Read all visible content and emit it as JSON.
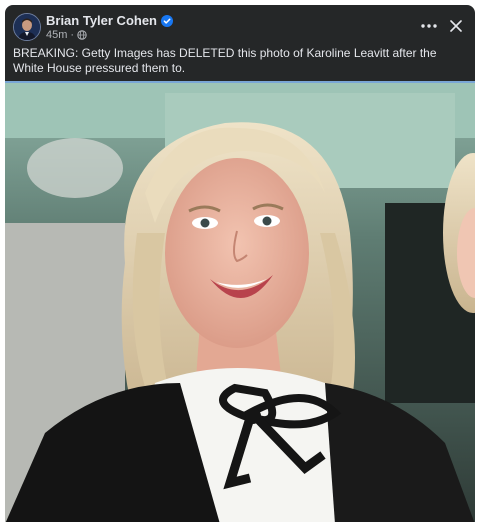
{
  "post": {
    "author": "Brian Tyler Cohen",
    "timestamp": "45m",
    "separator": "·",
    "caption": "BREAKING: Getty Images has DELETED this photo of Karoline Leavitt after the White House pressured them to."
  },
  "icons": {
    "verified": "verified-badge-icon",
    "audience": "globe-icon",
    "more": "more-options-icon",
    "close": "close-icon"
  },
  "colors": {
    "card_background": "#252728",
    "primary_text": "#e4e6eb",
    "secondary_text": "#b0b3b8",
    "verified_blue": "#1877f2"
  }
}
